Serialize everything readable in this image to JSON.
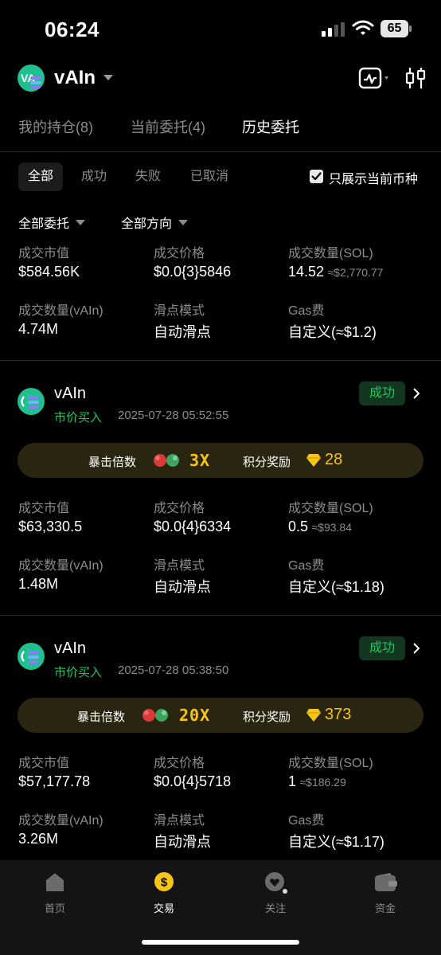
{
  "status_bar": {
    "time": "06:24",
    "battery": "65"
  },
  "header": {
    "title": "vAIn"
  },
  "main_tabs": [
    {
      "label": "我的持仓(8)"
    },
    {
      "label": "当前委托(4)"
    },
    {
      "label": "历史委托"
    }
  ],
  "filter_tabs": [
    {
      "label": "全部"
    },
    {
      "label": "成功"
    },
    {
      "label": "失败"
    },
    {
      "label": "已取消"
    }
  ],
  "only_current": {
    "label": "只展示当前币种",
    "checked": true
  },
  "dropdowns": {
    "order_type": "全部委托",
    "direction": "全部方向"
  },
  "labels": {
    "trade_value": "成交市值",
    "trade_price": "成交价格",
    "trade_qty_sol": "成交数量(SOL)",
    "trade_qty_token": "成交数量(vAIn)",
    "slippage": "滑点模式",
    "gas": "Gas费",
    "crit": "暴击倍数",
    "points": "积分奖励"
  },
  "partial_order": {
    "trade_value": "$584.56K",
    "trade_price": "$0.0{3}5846",
    "qty_sol": "14.52",
    "qty_sol_usd": "≈$2,770.77",
    "qty_token": "4.74M",
    "slippage": "自动滑点",
    "gas": "自定义(≈$1.2)"
  },
  "orders": [
    {
      "token": "vAIn",
      "type": "市价买入",
      "time": "2025-07-28 05:52:55",
      "status": "成功",
      "crit": "3X",
      "points": "28",
      "trade_value": "$63,330.5",
      "trade_price": "$0.0{4}6334",
      "qty_sol": "0.5",
      "qty_sol_usd": "≈$93.84",
      "qty_token": "1.48M",
      "slippage": "自动滑点",
      "gas": "自定义(≈$1.18)"
    },
    {
      "token": "vAIn",
      "type": "市价买入",
      "time": "2025-07-28 05:38:50",
      "status": "成功",
      "crit": "20X",
      "points": "373",
      "trade_value": "$57,177.78",
      "trade_price": "$0.0{4}5718",
      "qty_sol": "1",
      "qty_sol_usd": "≈$186.29",
      "qty_token": "3.26M",
      "slippage": "自动滑点",
      "gas": "自定义(≈$1.17)"
    }
  ],
  "tab_bar": [
    {
      "label": "首页",
      "icon": "home-icon"
    },
    {
      "label": "交易",
      "icon": "trade-icon"
    },
    {
      "label": "关注",
      "icon": "heart-icon"
    },
    {
      "label": "资金",
      "icon": "wallet-icon"
    }
  ],
  "colors": {
    "accent_green": "#22c55e",
    "gold": "#f5c518",
    "background": "#000000"
  }
}
